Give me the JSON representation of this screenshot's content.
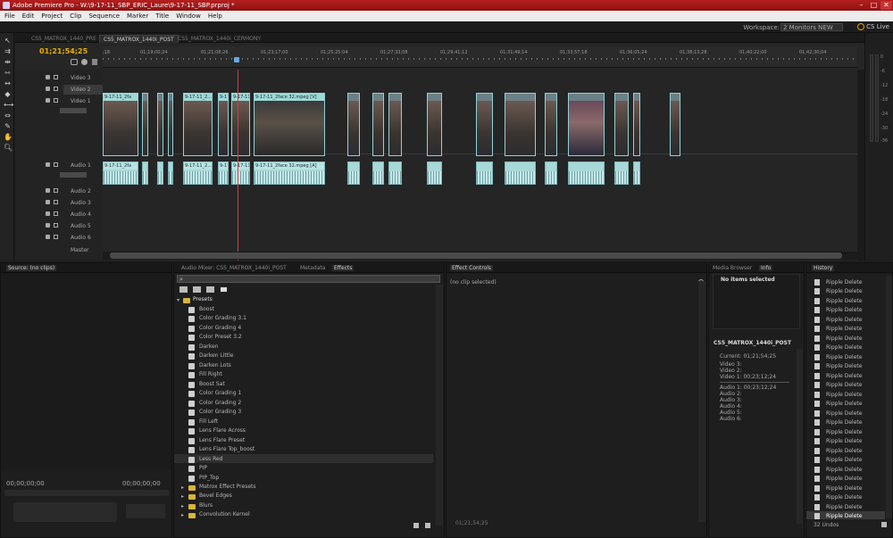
{
  "title": "Adobe Premiere Pro - W:\\9-17-11_SBP_ERIC_Laure\\9-17-11_SBP.prproj *",
  "menu": [
    "File",
    "Edit",
    "Project",
    "Clip",
    "Sequence",
    "Marker",
    "Title",
    "Window",
    "Help"
  ],
  "workspace": {
    "label": "Workspace:",
    "value": "2 Monitors NEW",
    "cslive": "CS Live"
  },
  "seq_tabs": [
    "CS5_MATROX_1440_PRE",
    "CS5_MATROX_1440i_POST",
    "CS5_MATROX_1440i_CERMONY"
  ],
  "timecode": "01;21;54;25",
  "ruler_ticks": [
    ";18",
    "01;19;00;24",
    "01;21;08;26",
    "01;23;17;00",
    "01;25;25;04",
    "01;27;33;08",
    "01;29;41;12",
    "01;31;49;14",
    "01;33;57;18",
    "01;36;05;24",
    "01;38;13;28",
    "01;40;22;00",
    "01;42;30;04"
  ],
  "tracks": {
    "v3": "Video 3",
    "v2": "Video 2",
    "v1": "Video 1",
    "a1": "Audio 1",
    "a2": "Audio 2",
    "a3": "Audio 3",
    "a4": "Audio 4",
    "a5": "Audio 5",
    "a6": "Audio 6",
    "master": "Master"
  },
  "clip_labels": {
    "v1": "9-17-11_2fa",
    "v2": "9-17-11_2...",
    "v3": "9-17-11_2",
    "v4": "9-17-11_2face 3",
    "v5": "9-17-11_2face 32.mpeg [V]",
    "a1": "9-17-11_2fa",
    "a2": "9-17-11_2...",
    "a3": "9-17-11_2",
    "a4": "9-17-11_2face 3",
    "a5": "9-17-11_2face 32.mpeg [A]"
  },
  "source": {
    "tab": "Source: (no clips)",
    "tc_left": "00;00;00;00",
    "tc_right": "00;00;00;00"
  },
  "effects_tabs": [
    "Audio Mixer: CS5_MATROX_1440i_POST",
    "Metadata",
    "Effects"
  ],
  "presets_label": "Presets",
  "presets": [
    "Boost",
    "Color Grading 3.1",
    "Color Grading 4",
    "Color Preset 3.2",
    "Darken",
    "Darken Little",
    "Darken Lots",
    "Fill Right",
    "Boost Sat",
    "Color Grading 1",
    "Color Grading 2",
    "Color Grading 3",
    "Fill Left",
    "Lens Flare Across",
    "Lens Flare Preset",
    "Lens Flare Top_boost",
    "Less Red",
    "PIP",
    "PIP_Top"
  ],
  "preset_folders": [
    "Matrox Effect Presets",
    "Bevel Edges",
    "Blurs",
    "Convolution Kernel"
  ],
  "effect_controls": {
    "tab": "Effect Controls",
    "noclip": "(no clip selected)",
    "tc": "01;21;54;25"
  },
  "info_tabs": [
    "Media Browser",
    "Info"
  ],
  "info": {
    "no_items": "No items selected",
    "seq": "CS5_MATROX_1440i_POST",
    "current": "Current:  01;21;54;25",
    "lines": [
      "Video 3:",
      "Video 2:",
      "Video 1:  00;23;12;24",
      "Audio 1:  00;23;12;24",
      "Audio 2:",
      "Audio 3:",
      "Audio 4:",
      "Audio 5:",
      "Audio 6:"
    ]
  },
  "history": {
    "tab": "History",
    "items": [
      "Ripple Delete",
      "Ripple Delete",
      "Ripple Delete",
      "Ripple Delete",
      "Ripple Delete",
      "Ripple Delete",
      "Ripple Delete",
      "Ripple Delete",
      "Ripple Delete",
      "Ripple Delete",
      "Ripple Delete",
      "Ripple Delete",
      "Ripple Delete",
      "Ripple Delete",
      "Ripple Delete",
      "Ripple Delete",
      "Ripple Delete",
      "Ripple Delete",
      "Ripple Delete",
      "Ripple Delete",
      "Ripple Delete",
      "Ripple Delete",
      "Ripple Delete",
      "Ripple Delete",
      "Ripple Delete",
      "Ripple Delete"
    ],
    "undos": "32 Undos"
  },
  "meter_ticks": [
    "0",
    "-6",
    "-12",
    "-18",
    "-24",
    "-30",
    "-36"
  ],
  "accent": "#e8b000"
}
